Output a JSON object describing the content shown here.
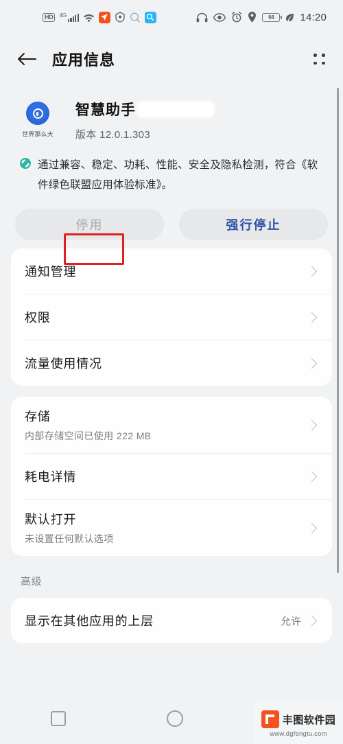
{
  "statusbar": {
    "hd_badge": "HD",
    "network_gen": "4G",
    "icons_left": [
      "hd-icon",
      "signal-bars-icon",
      "wifi-icon",
      "navigation-app-icon",
      "shield-app-icon",
      "search-bubble-icon",
      "search-app-icon"
    ],
    "icons_right": [
      "headphone-icon",
      "eye-comfort-icon",
      "alarm-icon",
      "location-icon",
      "battery-icon",
      "leaf-icon"
    ],
    "battery_level": "98",
    "time": "14:20"
  },
  "appbar": {
    "back_icon": "back-arrow-icon",
    "title": "应用信息",
    "menu_icon": "four-dot-menu-icon"
  },
  "app": {
    "icon_caption": "世界那么大",
    "name": "智慧助手",
    "version": "版本 12.0.1.303",
    "redacted": true
  },
  "certification": {
    "icon": "green-alliance-badge-icon",
    "text": "通过兼容、稳定、功耗、性能、安全及隐私检测，符合《软件绿色联盟应用体验标准》。"
  },
  "actions": {
    "disable_label": "停用",
    "force_stop_label": "强行停止",
    "highlight_color": "#e02020",
    "primary_color": "#2f53a8"
  },
  "cards": [
    {
      "rows": [
        {
          "label": "通知管理",
          "sub": null,
          "value": null
        },
        {
          "label": "权限",
          "sub": null,
          "value": null
        },
        {
          "label": "流量使用情况",
          "sub": null,
          "value": null
        }
      ]
    },
    {
      "rows": [
        {
          "label": "存储",
          "sub": "内部存储空间已使用 222 MB",
          "value": null
        },
        {
          "label": "耗电详情",
          "sub": null,
          "value": null
        },
        {
          "label": "默认打开",
          "sub": "未设置任何默认选项",
          "value": null
        }
      ]
    }
  ],
  "advanced": {
    "section_title": "高级",
    "rows": [
      {
        "label": "显示在其他应用的上层",
        "sub": null,
        "value": "允许"
      }
    ]
  },
  "navbar": {
    "recent_icon": "square-recents-icon",
    "home_icon": "circle-home-icon",
    "back_icon": "triangle-back-icon"
  },
  "watermark": {
    "name": "丰图软件园",
    "url": "www.dgfengtu.com"
  }
}
